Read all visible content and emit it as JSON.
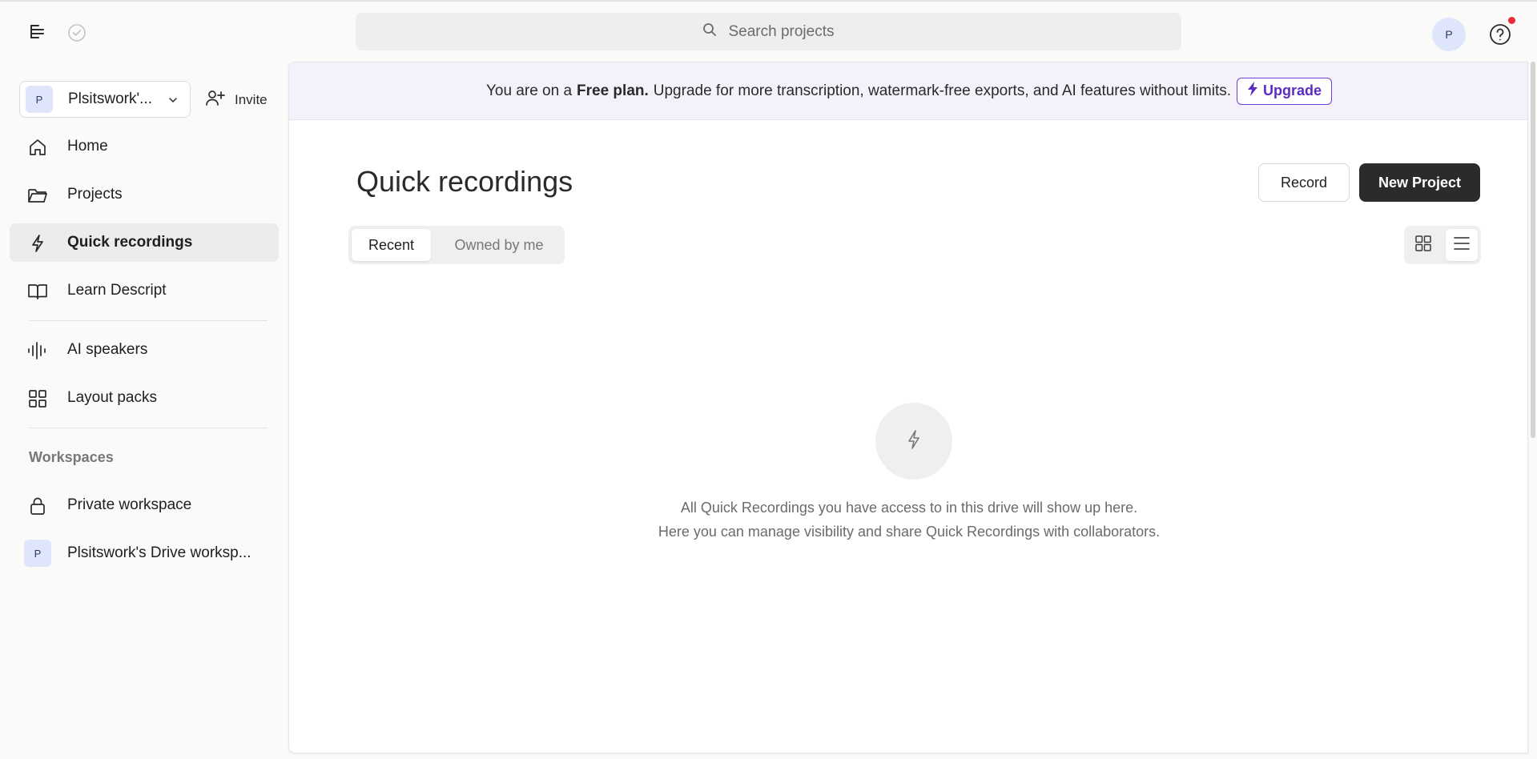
{
  "search": {
    "placeholder": "Search projects"
  },
  "user": {
    "avatar_initial": "P"
  },
  "workspace_switcher": {
    "initial": "P",
    "name": "Plsitswork'..."
  },
  "invite_label": "Invite",
  "nav": {
    "home": "Home",
    "projects": "Projects",
    "quick_recordings": "Quick recordings",
    "learn": "Learn Descript",
    "ai_speakers": "AI speakers",
    "layout_packs": "Layout packs"
  },
  "workspaces": {
    "title": "Workspaces",
    "private": "Private workspace",
    "drive_initial": "P",
    "drive": "Plsitswork's Drive worksp..."
  },
  "banner": {
    "prefix": "You are on a",
    "plan": "Free plan.",
    "suffix": "Upgrade for more transcription, watermark-free exports, and AI features without limits.",
    "upgrade_label": "Upgrade"
  },
  "main": {
    "title": "Quick recordings",
    "record_label": "Record",
    "new_project_label": "New Project",
    "tabs": [
      "Recent",
      "Owned by me"
    ],
    "empty_line1": "All Quick Recordings you have access to in this drive will show up here.",
    "empty_line2": "Here you can manage visibility and share Quick Recordings with collaborators."
  },
  "colors": {
    "accent_purple": "#5b2bc4",
    "banner_bg": "#f5f1fb",
    "dark_button": "#2b2b2b",
    "notification_dot": "#ef2a3a"
  },
  "icons": [
    "menu-logo-icon",
    "sync-check-icon",
    "search-icon",
    "help-icon",
    "chevron-down-icon",
    "add-user-icon",
    "home-icon",
    "folder-icon",
    "lightning-icon",
    "book-icon",
    "waveform-icon",
    "grid-icon",
    "lock-icon",
    "list-icon"
  ]
}
